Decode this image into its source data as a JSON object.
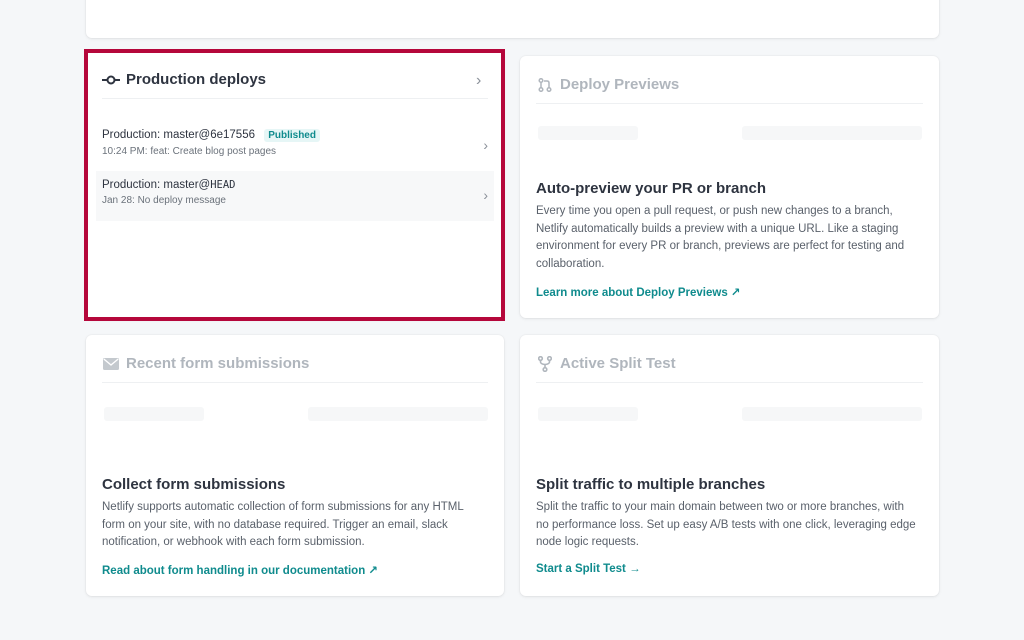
{
  "production": {
    "title": "Production deploys",
    "rows": [
      {
        "label": "Production:",
        "ref": "master@6e17556",
        "badge": "Published",
        "meta": "10:24 PM: feat: Create blog post pages"
      },
      {
        "label": "Production:",
        "ref": "master@",
        "ref_mono": "HEAD",
        "meta": "Jan 28: No deploy message"
      }
    ]
  },
  "previews": {
    "title": "Deploy Previews",
    "heading": "Auto-preview your PR or branch",
    "description": "Every time you open a pull request, or push new changes to a branch, Netlify automatically builds a preview with a unique URL. Like a staging environment for every PR or branch, previews are perfect for testing and collaboration.",
    "link": "Learn more about Deploy Previews ↗"
  },
  "forms": {
    "title": "Recent form submissions",
    "heading": "Collect form submissions",
    "description": "Netlify supports automatic collection of form submissions for any HTML form on your site, with no database required. Trigger an email, slack notification, or webhook with each form submission.",
    "link": "Read about form handling in our documentation ↗"
  },
  "split": {
    "title": "Active Split Test",
    "heading": "Split traffic to multiple branches",
    "description": "Split the traffic to your main domain between two or more branches, with no performance loss. Set up easy A/B tests with one click, leveraging edge node logic requests.",
    "link": "Start a Split Test →"
  },
  "colors": {
    "accent": "#0f8b8d",
    "highlight": "#b5073b"
  }
}
